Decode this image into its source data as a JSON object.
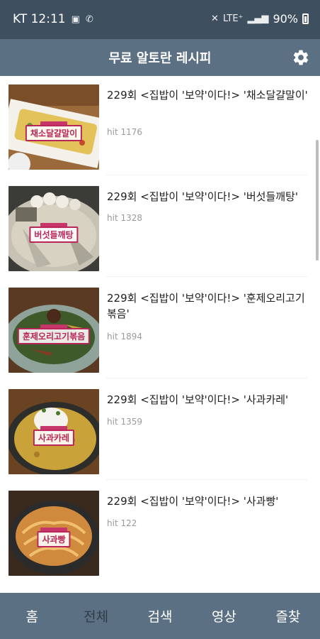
{
  "status_bar": {
    "carrier_time": "KT 12:11",
    "network": "LTE⁺",
    "battery": "90%"
  },
  "app_bar": {
    "title": "무료 알토란 레시피"
  },
  "recipes": [
    {
      "title": "229회 <집밥이 '보약'이다!> '채소달걀말이'",
      "hit": "hit 1176",
      "thumb_label": "채소달걀말이"
    },
    {
      "title": "229회 <집밥이 '보약'이다!> '버섯들깨탕'",
      "hit": "hit 1328",
      "thumb_label": "버섯들깨탕"
    },
    {
      "title": "229회 <집밥이 '보약'이다!> '훈제오리고기볶음'",
      "hit": "hit 1894",
      "thumb_label": "훈제오리고기볶음"
    },
    {
      "title": "229회 <집밥이 '보약'이다!> '사과카레'",
      "hit": "hit 1359",
      "thumb_label": "사과카레"
    },
    {
      "title": "229회 <집밥이 '보약'이다!> '사과빵'",
      "hit": "hit 122",
      "thumb_label": "사과빵"
    }
  ],
  "bottom_nav": [
    {
      "label": "홈"
    },
    {
      "label": "전체",
      "active": true
    },
    {
      "label": "검색"
    },
    {
      "label": "영상"
    },
    {
      "label": "즐찾"
    }
  ],
  "colors": {
    "status_bar": "#3e4f5f",
    "app_bar": "#5b7082",
    "nav_bar": "#5b7082",
    "tag": "#b8265a"
  }
}
